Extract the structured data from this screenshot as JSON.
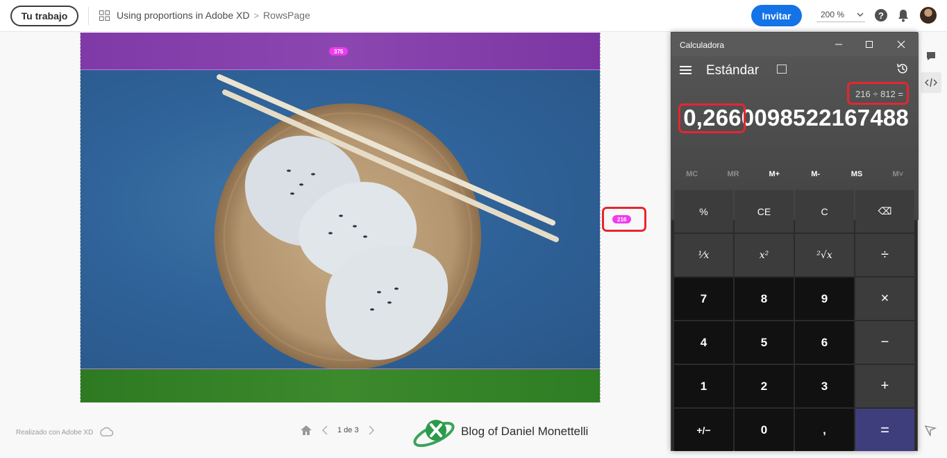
{
  "header": {
    "work_button": "Tu trabajo",
    "breadcrumb": {
      "project": "Using proportions in Adobe XD",
      "separator": ">",
      "page": "RowsPage"
    },
    "invite_button": "Invitar",
    "zoom": "200 %",
    "help": "?"
  },
  "artboard": {
    "top_badge": "375",
    "side_badge": "216"
  },
  "calculator": {
    "title": "Calculadora",
    "mode": "Estándar",
    "expression": "216 ÷ 812 =",
    "result": "0,2660098522167488",
    "memory": [
      "MC",
      "MR",
      "M+",
      "M-",
      "MS",
      "M˅"
    ],
    "keys": [
      "%",
      "CE",
      "C",
      "⌫",
      "¹⁄x",
      "x²",
      "²√x",
      "÷",
      "7",
      "8",
      "9",
      "×",
      "4",
      "5",
      "6",
      "−",
      "1",
      "2",
      "3",
      "+",
      "+/−",
      "0",
      ",",
      "="
    ]
  },
  "footer": {
    "made_with": "Realizado con Adobe XD",
    "pager": "1 de 3",
    "blog": "Blog of Daniel Monettelli"
  },
  "colors": {
    "invite": "#1473e6",
    "highlight": "#e8252f",
    "badge": "#ef3bf0",
    "band_top": "#8c46b0",
    "band_bottom": "#3c8a2c",
    "photo_bg": "#2f6399",
    "equals_key": "#3f3e7c"
  }
}
